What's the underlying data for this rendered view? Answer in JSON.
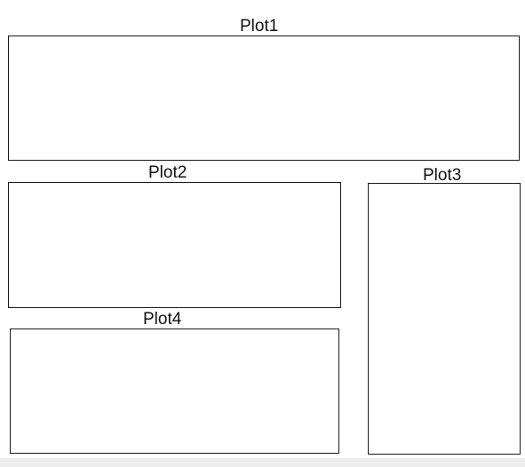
{
  "panels": [
    {
      "id": "plot1",
      "label": "Plot1"
    },
    {
      "id": "plot2",
      "label": "Plot2"
    },
    {
      "id": "plot3",
      "label": "Plot3"
    },
    {
      "id": "plot4",
      "label": "Plot4"
    }
  ],
  "colors": {
    "border": "#1a1a1a",
    "text": "#111111",
    "background": "#ffffff"
  }
}
